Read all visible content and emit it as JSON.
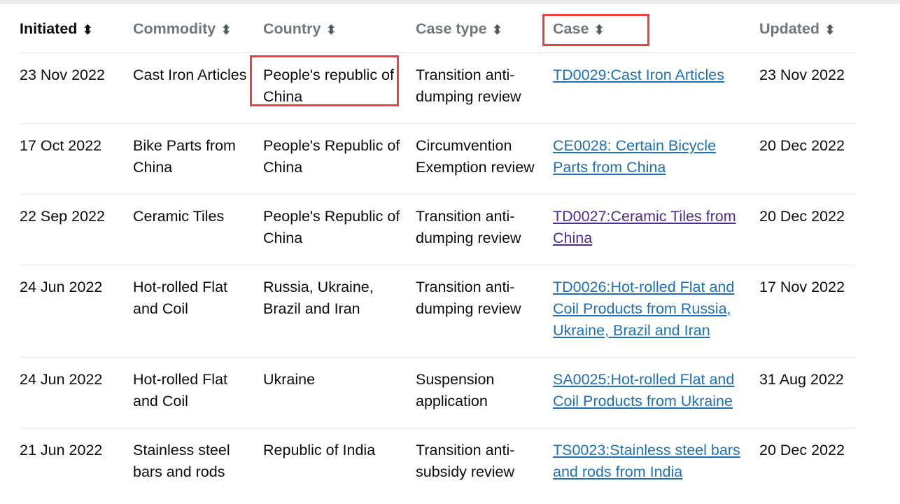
{
  "table": {
    "sort_icon": "sort-updown-icon",
    "columns": [
      {
        "key": "initiated",
        "label": "Initiated",
        "sorted": true
      },
      {
        "key": "commodity",
        "label": "Commodity",
        "sorted": false
      },
      {
        "key": "country",
        "label": "Country",
        "sorted": false
      },
      {
        "key": "casetype",
        "label": "Case type",
        "sorted": false
      },
      {
        "key": "case",
        "label": "Case",
        "sorted": false
      },
      {
        "key": "updated",
        "label": "Updated",
        "sorted": false
      }
    ],
    "rows": [
      {
        "initiated": "23 Nov 2022",
        "commodity": "Cast Iron Articles",
        "country": "People's republic of China",
        "casetype": "Transition anti-dumping review",
        "case": "TD0029:Cast Iron Articles",
        "case_visited": false,
        "updated": "23 Nov 2022"
      },
      {
        "initiated": "17 Oct 2022",
        "commodity": "Bike Parts from China",
        "country": "People's Republic of China",
        "casetype": "Circumvention Exemption review",
        "case": "CE0028: Certain Bicycle Parts from China",
        "case_visited": false,
        "updated": "20 Dec 2022"
      },
      {
        "initiated": "22 Sep 2022",
        "commodity": "Ceramic Tiles",
        "country": "People's Republic of China",
        "casetype": "Transition anti-dumping review",
        "case": "TD0027:Ceramic Tiles from China",
        "case_visited": true,
        "updated": "20 Dec 2022"
      },
      {
        "initiated": "24 Jun 2022",
        "commodity": "Hot-rolled Flat and Coil",
        "country": "Russia, Ukraine, Brazil and Iran",
        "casetype": "Transition anti-dumping review",
        "case": "TD0026:Hot-rolled Flat and Coil Products from Russia, Ukraine, Brazil and Iran",
        "case_visited": false,
        "updated": "17 Nov 2022"
      },
      {
        "initiated": "24 Jun 2022",
        "commodity": "Hot-rolled Flat and Coil",
        "country": "Ukraine",
        "casetype": "Suspension application",
        "case": "SA0025:Hot-rolled Flat and Coil Products from Ukraine",
        "case_visited": false,
        "updated": "31 Aug 2022"
      },
      {
        "initiated": "21 Jun 2022",
        "commodity": "Stainless steel bars and rods",
        "country": "Republic of India",
        "casetype": "Transition anti-subsidy review",
        "case": "TS0023:Stainless steel bars and rods from India",
        "case_visited": false,
        "updated": "20 Dec 2022"
      }
    ]
  },
  "annotations": [
    {
      "name": "case-header-highlight",
      "target": "Case",
      "color": "#ef3e3e"
    },
    {
      "name": "country-cell-highlight",
      "target": "People's republic of China",
      "color": "#ef3e3e"
    }
  ],
  "colors": {
    "link": "#1d70b8",
    "link_visited": "#4c2c92",
    "text": "#0b0c0c",
    "muted_header": "#6f777b",
    "rule": "#e6e6e6",
    "annotation": "#ef3e3e"
  }
}
